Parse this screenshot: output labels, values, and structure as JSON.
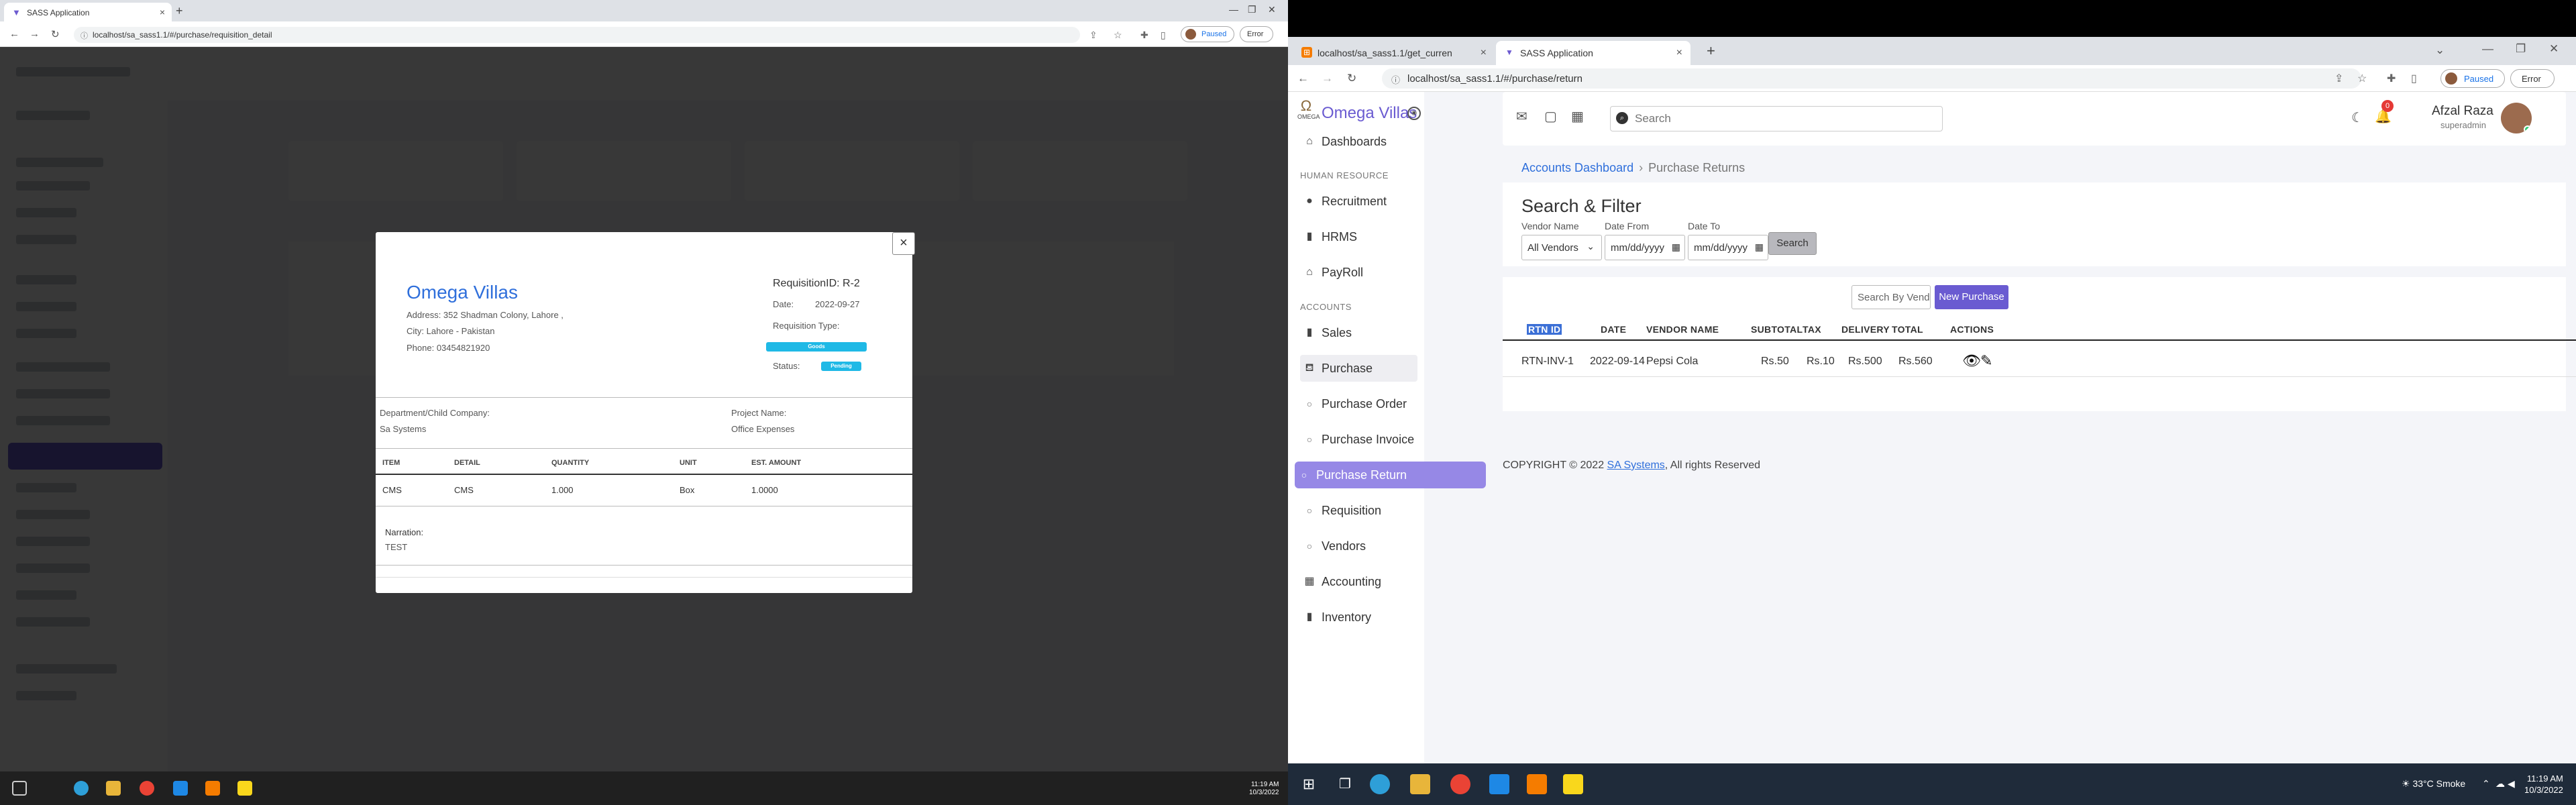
{
  "left": {
    "tab": {
      "title": "SASS Application"
    },
    "url": "localhost/sa_sass1.1/#/purchase/requisition_detail",
    "paused_label": "Paused",
    "error_label": "Error",
    "modal": {
      "company": "Omega Villas",
      "address_line1": "Address: 352 Shadman Colony, Lahore ,",
      "address_line2": "City: Lahore - Pakistan",
      "phone": "Phone: 03454821920",
      "requisition_id": "RequisitionID: R-2",
      "date_label": "Date:",
      "date_value": "2022-09-27",
      "req_type_label": "Requisition Type:",
      "req_type_value": "Goods",
      "status_label": "Status:",
      "status_value": "Pending",
      "dept_label": "Department/Child Company:",
      "dept_value": "Sa Systems",
      "project_label": "Project Name:",
      "project_value": "Office Expenses",
      "table_headers": [
        "ITEM",
        "DETAIL",
        "QUANTITY",
        "UNIT",
        "EST. AMOUNT"
      ],
      "table_row": [
        "CMS",
        "CMS",
        "1.000",
        "Box",
        "1.0000"
      ],
      "narration_label": "Narration:",
      "narration_value": "TEST",
      "close_glyph": "×"
    },
    "clock": {
      "time": "11:19 AM",
      "date": "10/3/2022"
    }
  },
  "right": {
    "tabs": [
      {
        "title": "localhost/sa_sass1.1/get_curren"
      },
      {
        "title": "SASS Application"
      }
    ],
    "url": "localhost/sa_sass1.1/#/purchase/return",
    "paused_label": "Paused",
    "error_label": "Error",
    "brand": "Omega Villas",
    "logo_text": "OMEGA",
    "sidebar": {
      "dashboards": "Dashboards",
      "section_hr": "HUMAN RESOURCE",
      "recruitment": "Recruitment",
      "hrms": "HRMS",
      "payroll": "PayRoll",
      "section_accounts": "ACCOUNTS",
      "sales": "Sales",
      "purchase": "Purchase",
      "purchase_order": "Purchase Order",
      "purchase_invoice": "Purchase Invoice",
      "purchase_return": "Purchase Return",
      "requisition": "Requisition",
      "vendors": "Vendors",
      "accounting": "Accounting",
      "inventory": "Inventory"
    },
    "topbar": {
      "search_placeholder": "Search",
      "notif_count": "0",
      "user_name": "Afzal Raza",
      "user_role": "superadmin"
    },
    "breadcrumb": {
      "parent": "Accounts Dashboard",
      "current": "Purchase Returns",
      "sep": "›"
    },
    "filter": {
      "title": "Search & Filter",
      "vendor_label": "Vendor Name",
      "vendor_value": "All Vendors",
      "date_from_label": "Date From",
      "date_to_label": "Date To",
      "date_placeholder": "mm/dd/yyyy",
      "search_button": "Search"
    },
    "list": {
      "vendor_search_placeholder": "Search By Vendor Name",
      "new_button": "New Purchase Return",
      "headers": [
        "RTN ID",
        "DATE",
        "VENDOR NAME",
        "SUBTOTAL",
        "TAX",
        "DELIVERY",
        "TOTAL",
        "ACTIONS"
      ],
      "rows": [
        {
          "rtn_id": "RTN-INV-1",
          "date": "2022-09-14",
          "vendor": "Pepsi Cola",
          "subtotal": "Rs.50",
          "tax": "Rs.10",
          "delivery": "Rs.500",
          "total": "Rs.560"
        }
      ]
    },
    "footer": {
      "prefix": "COPYRIGHT © 2022 ",
      "link": "SA Systems",
      "suffix": ", All rights Reserved"
    },
    "taskbar": {
      "weather": "33°C  Smoke",
      "time": "11:19 AM",
      "date": "10/3/2022"
    }
  }
}
